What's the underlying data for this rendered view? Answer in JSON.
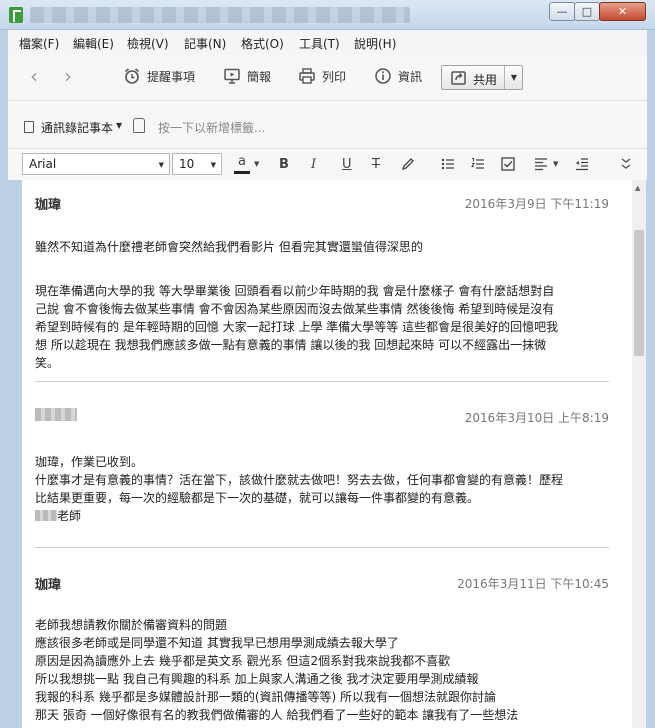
{
  "menu": [
    "檔案(F)",
    "編輯(E)",
    "檢視(V)",
    "記事(N)",
    "格式(O)",
    "工具(T)",
    "說明(H)"
  ],
  "toolbar": {
    "reminder_label": "提醒事項",
    "present_label": "簡報",
    "print_label": "列印",
    "info_label": "資訊",
    "share_label": "共用"
  },
  "notebook": {
    "name": "通訊錄記事本",
    "tag_placeholder": "按一下以新增標籤..."
  },
  "format": {
    "font": "Arial",
    "size": "10",
    "text_color": "a",
    "bold": "B",
    "italic": "I",
    "underline": "U",
    "strike": "T"
  },
  "entries": [
    {
      "author": "珈瑋",
      "timestamp": "2016年3月9日 下午11:19",
      "lines": [
        "雖然不知道為什麼禮老師會突然給我們看影片 但看完其實還蠻值得深思的",
        "現在準備邁向大學的我 等大學畢業後 回頭看看以前少年時期的我 會是什麼樣子 會有什麼話想對自",
        "己說  會不會後悔去做某些事情  會不會因為某些原因而沒去做某些事情 然後後悔  希望到時候是沒有",
        "希望到時候有的 是年輕時期的回憶 大家一起打球 上學 準備大學等等 這些都會是很美好的回憶吧我",
        "想 所以趁現在 我想我們應該多做一點有意義的事情 讓以後的我 回想起來時 可以不經露出一抹微",
        "笑。"
      ]
    },
    {
      "author": "",
      "timestamp": "2016年3月10日 上午8:19",
      "lines": [
        "珈瑋，作業已收到。",
        "什麼事才是有意義的事情？活在當下，該做什麼就去做吧！努去去做，任何事都會變的有意義！歷程",
        "比結果更重要，每一次的經驗都是下一次的基礎，就可以讓每一件事都變的有意義。",
        "老師"
      ]
    },
    {
      "author": "珈瑋",
      "timestamp": "2016年3月11日 下午10:45",
      "lines": [
        "老師我想請教你關於備審資料的問題",
        "應該很多老師或是同學還不知道 其實我早已想用學測成績去報大學了",
        "原因是因為讀應外上去 幾乎都是英文系 觀光系 但這2個系對我來說我都不喜歡",
        "所以我想挑一點 我自己有興趣的科系 加上與家人溝通之後 我才決定要用學測成績報",
        "我報的科系 幾乎都是多媒體設計那一類的(資訊傳播等等)  所以我有一個想法就跟你討論",
        "那天 張奇   一個好像很有名的教我們做備審的人 給我們看了一些好的範本 讓我有了一些想法"
      ]
    }
  ]
}
